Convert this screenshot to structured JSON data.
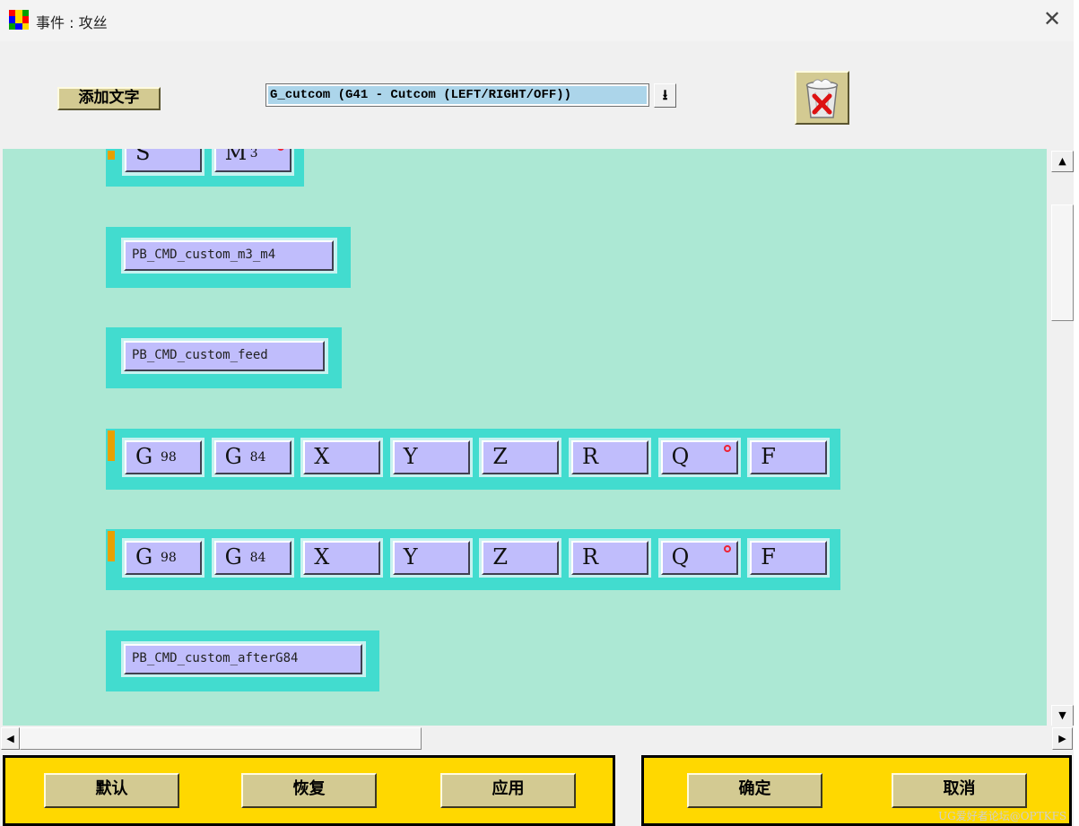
{
  "window": {
    "title": "事件 : 攻丝",
    "close_glyph": "✕",
    "icon": "app-grid-icon",
    "icon_colors": [
      "#ff0000",
      "#ffd800",
      "#00a000",
      "#0000ff",
      "#ffd800",
      "#ff0000",
      "#00a000",
      "#0000ff",
      "#ffd800"
    ]
  },
  "toolbar": {
    "add_text_label": "添加文字",
    "command_select_value": "G_cutcom (G41 - Cutcom (LEFT/RIGHT/OFF))",
    "dropdown_icon": "download-arrow-icon",
    "dropdown_glyph": "⭳",
    "trash_icon": "trash-delete-icon"
  },
  "canvas": {
    "background": "#ace8d4",
    "block_color": "#42dccf",
    "button_color": "#c0bdfc",
    "marker_color": "#e8a000",
    "blocks": [
      {
        "kind": "words",
        "marker": true,
        "words": [
          {
            "char": "S",
            "sub": ""
          },
          {
            "char": "M",
            "sub": "3",
            "optional": true
          }
        ]
      },
      {
        "kind": "command",
        "label": "PB_CMD_custom_m3_m4"
      },
      {
        "kind": "command",
        "label": "PB_CMD_custom_feed"
      },
      {
        "kind": "words",
        "marker": true,
        "words": [
          {
            "char": "G",
            "sub": "98"
          },
          {
            "char": "G",
            "sub": "84"
          },
          {
            "char": "X",
            "sub": ""
          },
          {
            "char": "Y",
            "sub": ""
          },
          {
            "char": "Z",
            "sub": ""
          },
          {
            "char": "R",
            "sub": ""
          },
          {
            "char": "Q",
            "sub": "",
            "optional": true
          },
          {
            "char": "F",
            "sub": ""
          }
        ]
      },
      {
        "kind": "words",
        "marker": true,
        "words": [
          {
            "char": "G",
            "sub": "98"
          },
          {
            "char": "G",
            "sub": "84"
          },
          {
            "char": "X",
            "sub": ""
          },
          {
            "char": "Y",
            "sub": ""
          },
          {
            "char": "Z",
            "sub": ""
          },
          {
            "char": "R",
            "sub": ""
          },
          {
            "char": "Q",
            "sub": "",
            "optional": true
          },
          {
            "char": "F",
            "sub": ""
          }
        ]
      },
      {
        "kind": "command",
        "label": "PB_CMD_custom_afterG84"
      }
    ]
  },
  "scrollbars": {
    "up_glyph": "▲",
    "down_glyph": "▼",
    "left_glyph": "◀",
    "right_glyph": "▶"
  },
  "footer": {
    "default_label": "默认",
    "restore_label": "恢复",
    "apply_label": "应用",
    "ok_label": "确定",
    "cancel_label": "取消",
    "panel_color": "#ffd800"
  },
  "watermark": "UG爱好者论坛@OPTKFS"
}
